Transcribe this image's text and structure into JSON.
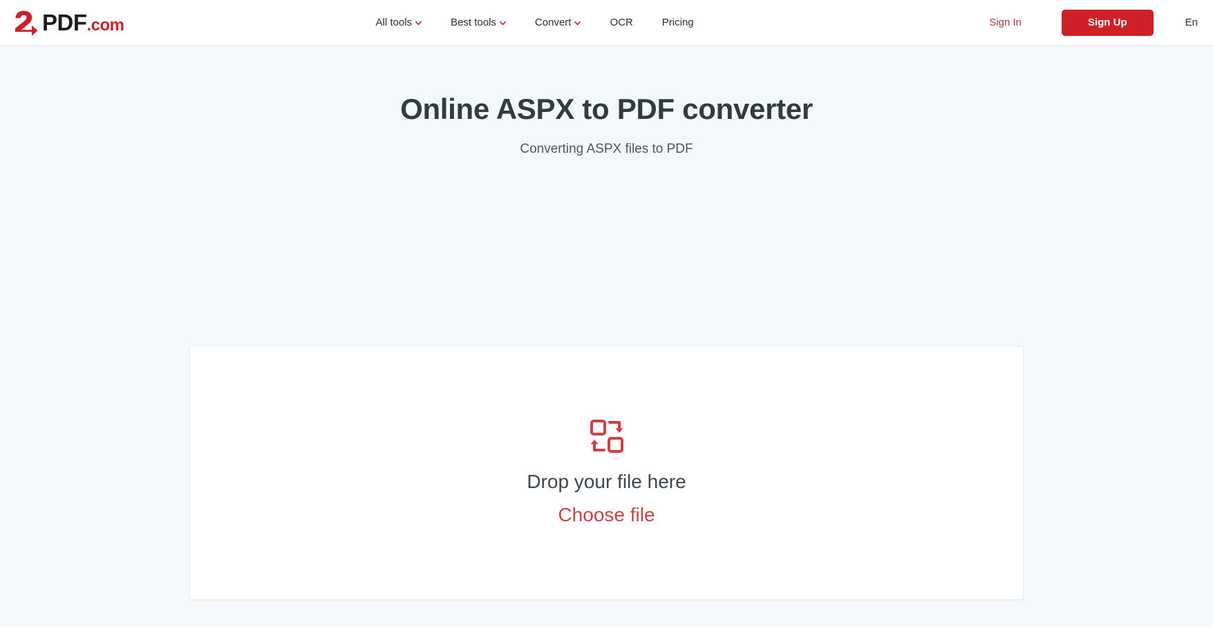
{
  "header": {
    "logo": {
      "mark": "2",
      "name": "PDF",
      "tld": ".com",
      "alt": "2PDF.com"
    },
    "nav": [
      {
        "label": "All tools",
        "has_dropdown": true
      },
      {
        "label": "Best tools",
        "has_dropdown": true
      },
      {
        "label": "Convert",
        "has_dropdown": true
      },
      {
        "label": "OCR",
        "has_dropdown": false
      },
      {
        "label": "Pricing",
        "has_dropdown": false
      }
    ],
    "sign_in_label": "Sign In",
    "sign_up_label": "Sign Up",
    "language": "En"
  },
  "main": {
    "title": "Online ASPX to PDF converter",
    "subtitle": "Converting ASPX files to PDF",
    "dropzone": {
      "icon": "convert-icon",
      "drop_text": "Drop your file here",
      "choose_label": "Choose file"
    }
  },
  "colors": {
    "brand_red": "#d02027",
    "accent_red": "#cf4040",
    "page_bg": "#f5f8fb",
    "header_bg": "#ffffff",
    "title_text": "#303b43"
  }
}
